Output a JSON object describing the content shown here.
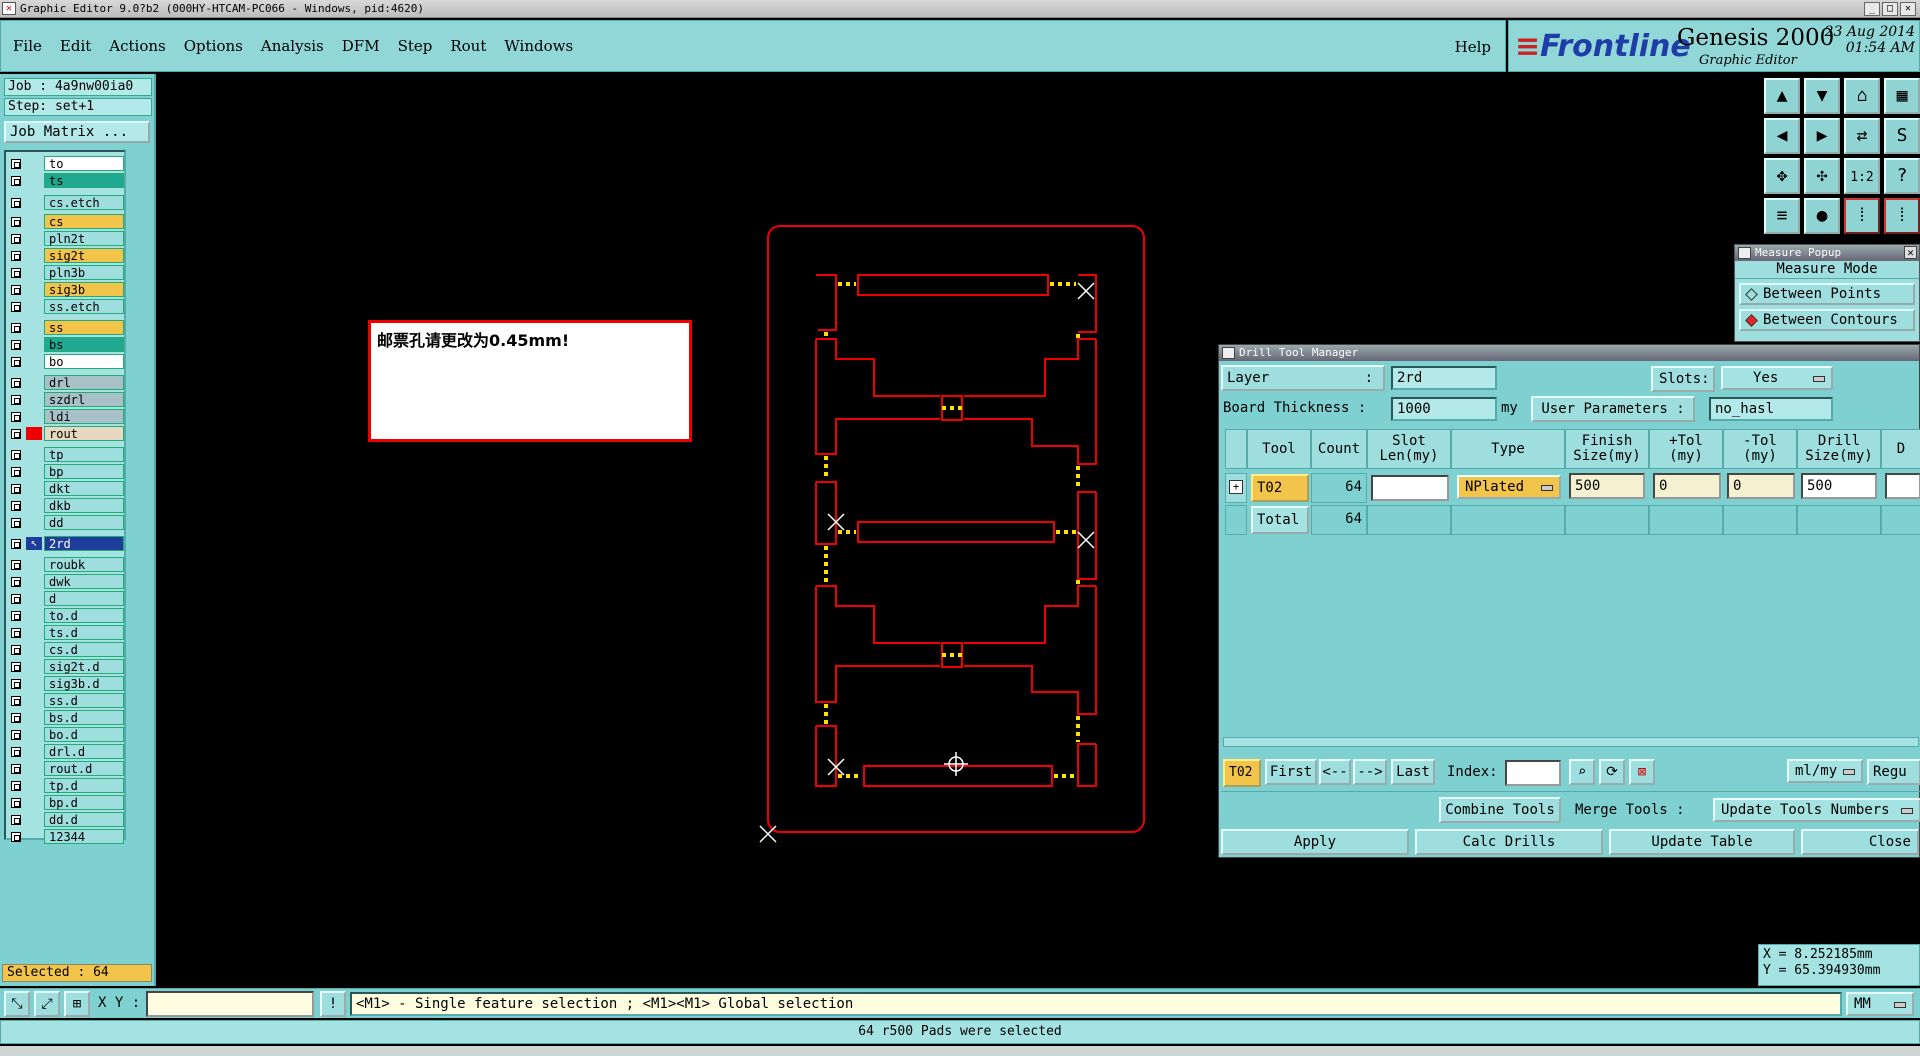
{
  "window": {
    "title": "Graphic Editor 9.0?b2 (000HY-HTCAM-PC066 - Windows, pid:4620)"
  },
  "menu": {
    "items": [
      "File",
      "Edit",
      "Actions",
      "Options",
      "Analysis",
      "DFM",
      "Step",
      "Rout",
      "Windows"
    ],
    "help": "Help"
  },
  "brand": {
    "logo": "Frontline",
    "product": "Genesis 2000",
    "subtitle": "Graphic Editor",
    "date": "23 Aug 2014",
    "time": "01:54 AM"
  },
  "left": {
    "job": "Job : 4a9nw00ia0",
    "step": "Step: set+1",
    "job_matrix": "Job Matrix ...",
    "layers": [
      {
        "name": "to",
        "color": "#ffffff"
      },
      {
        "name": "ts",
        "color": "#20a890"
      },
      {
        "name": "cs.etch",
        "color": "#9fdede"
      },
      {
        "name": "cs",
        "color": "#f2c44a"
      },
      {
        "name": "pln2t",
        "color": "#9fdede"
      },
      {
        "name": "sig2t",
        "color": "#f2c44a"
      },
      {
        "name": "pln3b",
        "color": "#9fdede"
      },
      {
        "name": "sig3b",
        "color": "#f2c44a"
      },
      {
        "name": "ss.etch",
        "color": "#9fdede"
      },
      {
        "name": "ss",
        "color": "#f2c44a"
      },
      {
        "name": "bs",
        "color": "#20a890"
      },
      {
        "name": "bo",
        "color": "#ffffff"
      },
      {
        "name": "drl",
        "color": "#a8c0c8"
      },
      {
        "name": "szdrl",
        "color": "#a8c0c8"
      },
      {
        "name": "ldi",
        "color": "#a8c0c8"
      },
      {
        "name": "rout",
        "color": "#e8d8c0"
      },
      {
        "name": "tp",
        "color": "#9fdede"
      },
      {
        "name": "bp",
        "color": "#9fdede"
      },
      {
        "name": "dkt",
        "color": "#9fdede"
      },
      {
        "name": "dkb",
        "color": "#9fdede"
      },
      {
        "name": "dd",
        "color": "#9fdede"
      },
      {
        "name": "2rd",
        "color": "#1e3c9c"
      },
      {
        "name": "roubk",
        "color": "#9fdede"
      },
      {
        "name": "dwk",
        "color": "#9fdede"
      },
      {
        "name": "d",
        "color": "#9fdede"
      },
      {
        "name": "to.d",
        "color": "#9fdede"
      },
      {
        "name": "ts.d",
        "color": "#9fdede"
      },
      {
        "name": "cs.d",
        "color": "#9fdede"
      },
      {
        "name": "sig2t.d",
        "color": "#9fdede"
      },
      {
        "name": "sig3b.d",
        "color": "#9fdede"
      },
      {
        "name": "ss.d",
        "color": "#9fdede"
      },
      {
        "name": "bs.d",
        "color": "#9fdede"
      },
      {
        "name": "bo.d",
        "color": "#9fdede"
      },
      {
        "name": "drl.d",
        "color": "#9fdede"
      },
      {
        "name": "rout.d",
        "color": "#9fdede"
      },
      {
        "name": "tp.d",
        "color": "#9fdede"
      },
      {
        "name": "bp.d",
        "color": "#9fdede"
      },
      {
        "name": "dd.d",
        "color": "#9fdede"
      },
      {
        "name": "12344",
        "color": "#9fdede"
      }
    ],
    "selected": "Selected : 64"
  },
  "canvas": {
    "annotation": "邮票孔请更改为0.45mm!"
  },
  "tool_icons": [
    "zoom-in-icon",
    "zoom-out-icon",
    "home-icon",
    "grid-icon",
    "pan-left-icon",
    "pan-right-icon",
    "fit-icon",
    "snap-icon",
    "zoom-fit-icon",
    "zoom-area-icon",
    "ratio-icon",
    "help-icon",
    "layers-icon",
    "measure-icon",
    "drill-icon",
    "drill-edit-icon"
  ],
  "tool_labels": [
    "▲",
    "▼",
    "⌂",
    "▦",
    "◀",
    "▶",
    "⇄",
    "S",
    "✥",
    "✣",
    "1:2",
    "?",
    "≡",
    "●",
    "⁞",
    "⁞"
  ],
  "measure": {
    "title": "Measure Popup",
    "mode": "Measure Mode",
    "options": [
      "Between Points",
      "Between Contours"
    ]
  },
  "dtm": {
    "title": "Drill Tool Manager",
    "layer_label": "Layer",
    "layer_value": "2rd",
    "slots_label": "Slots:",
    "slots_value": "Yes",
    "board_thickness_label": "Board Thickness :",
    "board_thickness_value": "1000",
    "unit": "my",
    "user_params_label": "User Parameters :",
    "user_params_value": "no_hasl",
    "columns": [
      "Tool",
      "Count",
      "Slot\nLen(my)",
      "Type",
      "Finish\nSize(my)",
      "+Tol\n(my)",
      "-Tol\n(my)",
      "Drill\nSize(my)",
      "D"
    ],
    "row": {
      "tool": "T02",
      "count": "64",
      "slot_len": "",
      "type": "NPlated",
      "finish": "500",
      "ptol": "0",
      "mtol": "0",
      "drill": "500"
    },
    "total": {
      "label": "Total",
      "count": "64"
    },
    "nav": {
      "current": "T02",
      "first": "First",
      "prev": "<--",
      "next": "-->",
      "last": "Last",
      "index_label": "Index:",
      "index_value": "",
      "units": "ml/my",
      "regu": "Regu"
    },
    "combine": "Combine Tools",
    "merge_label": "Merge Tools :",
    "merge_value": "Update Tools Numbers",
    "apply": "Apply",
    "calc": "Calc Drills",
    "update": "Update Table",
    "close": "Close"
  },
  "coords": {
    "x": "X = 8.252185mm",
    "y": "Y = 65.394930mm"
  },
  "cmd": {
    "xy_label": "X Y :",
    "xy_value": "",
    "hint": "<M1> - Single feature selection ; <M1><M1> Global selection",
    "units": "MM"
  },
  "status": "64 r500 Pads were selected"
}
